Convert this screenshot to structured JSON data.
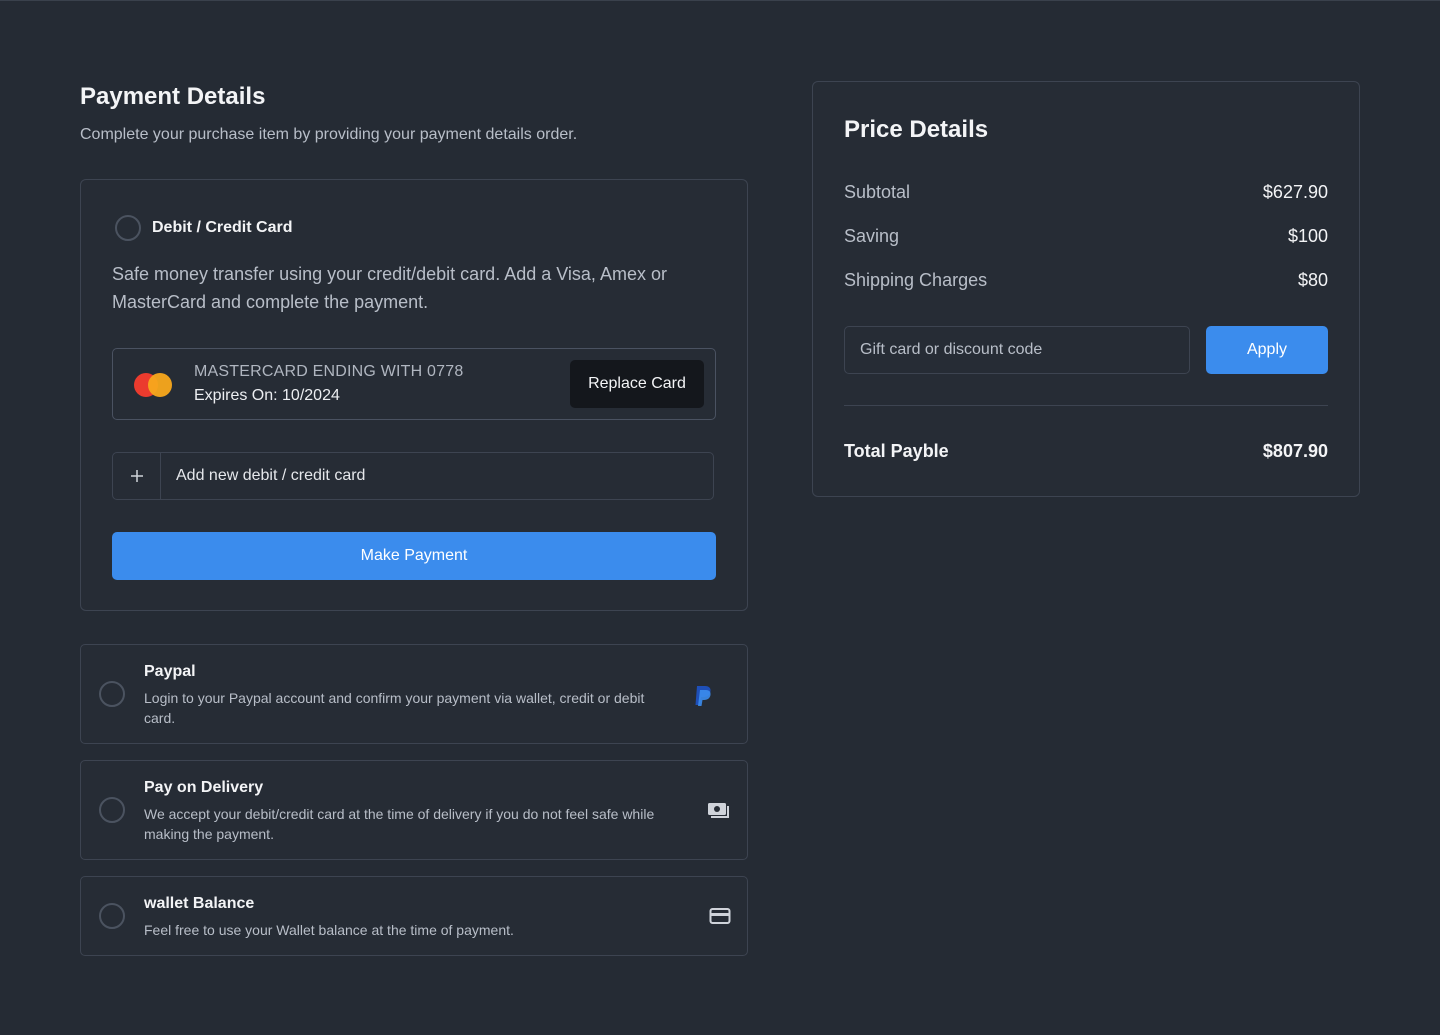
{
  "header": {
    "title": "Payment Details",
    "subtitle": "Complete your purchase item by providing your payment details order."
  },
  "card_method": {
    "title": "Debit / Credit Card",
    "description": "Safe money transfer using your credit/debit card. Add a Visa, Amex or MasterCard and complete the payment.",
    "saved_card": {
      "brand_icon": "mastercard-logo",
      "label": "MASTERCARD ENDING WITH 0778",
      "expiry": "Expires On: 10/2024",
      "replace_label": "Replace Card"
    },
    "add_card": {
      "icon": "plus-icon",
      "label": "Add new debit / credit card"
    },
    "make_payment_label": "Make Payment"
  },
  "options": [
    {
      "title": "Paypal",
      "description": "Login to your Paypal account and confirm your payment via wallet, credit or debit card.",
      "icon": "paypal-icon"
    },
    {
      "title": "Pay on Delivery",
      "description": "We accept your debit/credit card at the time of delivery if you do not feel safe while making the payment.",
      "icon": "cash-icon"
    },
    {
      "title": "wallet Balance",
      "description": "Feel free to use your Wallet balance at the time of payment.",
      "icon": "credit-card-icon"
    }
  ],
  "price": {
    "title": "Price Details",
    "rows": [
      {
        "label": "Subtotal",
        "value": "$627.90"
      },
      {
        "label": "Saving",
        "value": "$100"
      },
      {
        "label": "Shipping Charges",
        "value": "$80"
      }
    ],
    "discount_placeholder": "Gift card or discount code",
    "apply_label": "Apply",
    "total_label": "Total Payble",
    "total_value": "$807.90"
  },
  "colors": {
    "background": "#252b34",
    "accent": "#3b8ced",
    "border": "#3d4451"
  }
}
